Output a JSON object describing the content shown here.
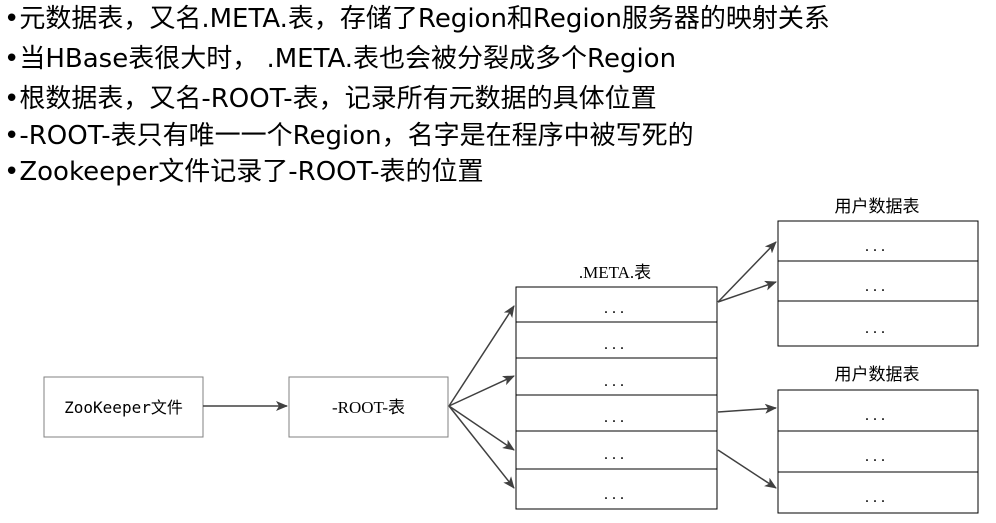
{
  "bullets": [
    "•元数据表，又名.META.表，存储了Region和Region服务器的映射关系",
    "•当HBase表很大时， .META.表也会被分裂成多个Region",
    "•根数据表，又名-ROOT-表，记录所有元数据的具体位置",
    "•-ROOT-表只有唯一一个Region，名字是在程序中被写死的",
    "•Zookeeper文件记录了-ROOT-表的位置"
  ],
  "diagram": {
    "zookeeper_label": "ZooKeeper文件",
    "root_label": "-ROOT-表",
    "meta_title": ".META.表",
    "meta_rows": [
      "...",
      "...",
      "...",
      "...",
      "...",
      "..."
    ],
    "user_table_top_title": "用户数据表",
    "user_table_top_rows": [
      "...",
      "...",
      "..."
    ],
    "user_table_bottom_title": "用户数据表",
    "user_table_bottom_rows": [
      "...",
      "...",
      "..."
    ]
  }
}
